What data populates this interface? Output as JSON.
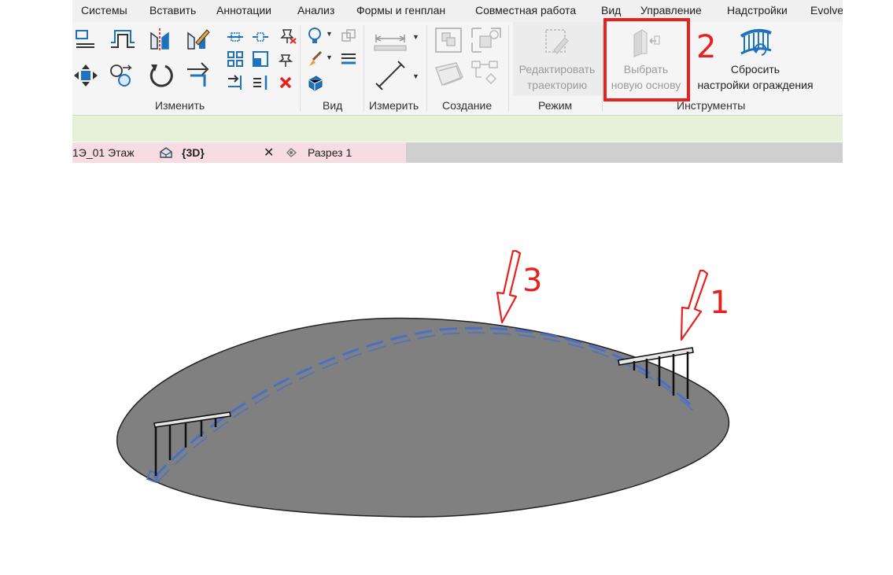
{
  "menu": {
    "items": [
      "Системы",
      "Вставить",
      "Аннотации",
      "Анализ",
      "Формы и генплан",
      "Совместная работа",
      "Вид",
      "Управление",
      "Надстройки",
      "Evolve"
    ]
  },
  "ribbon": {
    "groups": {
      "modify": "Изменить",
      "view": "Вид",
      "measure": "Измерить",
      "create": "Создание",
      "mode": "Режим",
      "tools": "Инструменты"
    },
    "edit_path": {
      "line1": "Редактировать",
      "line2": "траекторию"
    },
    "pick_host": {
      "line1": "Выбрать",
      "line2": "новую основу"
    },
    "reset_railing": {
      "line1": "Сбросить",
      "line2": "настройки ограждения"
    }
  },
  "tabs": {
    "tab1": "1Э_01 Этаж",
    "tab2": "{3D}",
    "tab3": "Разрез 1",
    "close_glyph": "✕"
  },
  "annotations": {
    "n1": "1",
    "n2": "2",
    "n3": "3"
  },
  "colors": {
    "accent_red": "#e8211e",
    "ribbon_blue": "#1e73be",
    "selection_blue": "#4a6fc8",
    "surface_grey": "#808080",
    "options_bar": "#e7f0d8",
    "tab_pink": "#f7dde3"
  }
}
